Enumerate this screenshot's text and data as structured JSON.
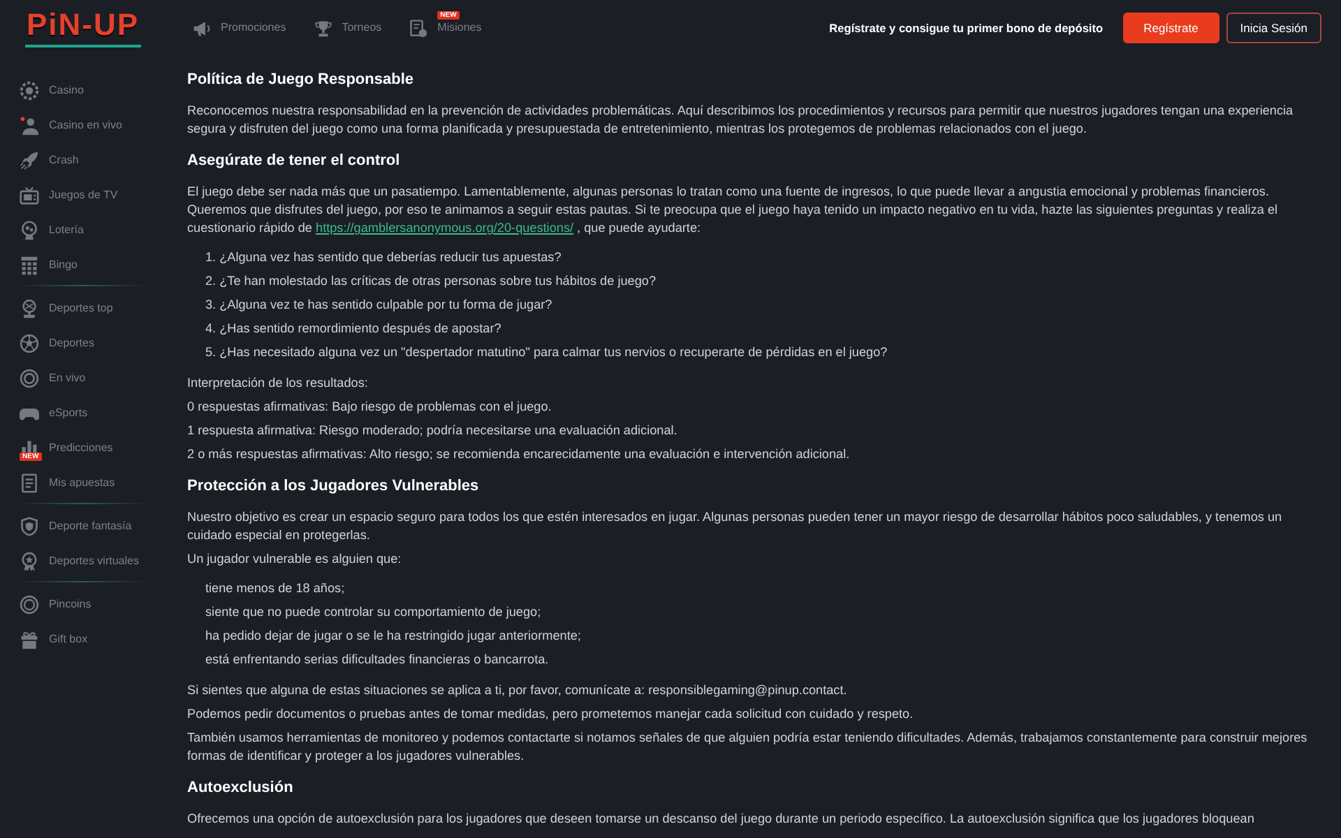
{
  "logo": {
    "text": "PiN-UP"
  },
  "sidebar": {
    "sections": [
      {
        "items": [
          {
            "label": "Casino"
          },
          {
            "label": "Casino en vivo"
          },
          {
            "label": "Crash"
          },
          {
            "label": "Juegos de TV"
          },
          {
            "label": "Lotería"
          },
          {
            "label": "Bingo"
          }
        ]
      },
      {
        "items": [
          {
            "label": "Deportes top"
          },
          {
            "label": "Deportes"
          },
          {
            "label": "En vivo"
          },
          {
            "label": "eSports"
          },
          {
            "label": "Predicciones",
            "badge": "NEW"
          },
          {
            "label": "Mis apuestas"
          }
        ]
      },
      {
        "items": [
          {
            "label": "Deporte fantasía"
          },
          {
            "label": "Deportes virtuales"
          }
        ]
      },
      {
        "items": [
          {
            "label": "Pincoins"
          },
          {
            "label": "Gift box"
          }
        ]
      }
    ]
  },
  "top_nav": [
    {
      "label": "Promociones"
    },
    {
      "label": "Torneos"
    },
    {
      "label": "Misiones",
      "badge": "NEW"
    }
  ],
  "header": {
    "promo": "Regístrate y consigue tu primer bono de depósito",
    "buttons": [
      {
        "label": "Regístrate",
        "kind": "primary"
      },
      {
        "label": "Inicia Sesión",
        "kind": "outline"
      }
    ]
  },
  "content": [
    {
      "kind": "heading",
      "text": "Política de Juego Responsable"
    },
    {
      "kind": "paragraph",
      "parts": [
        {
          "kind": "text",
          "text": "Reconocemos nuestra responsabilidad en la prevención de actividades problemáticas. Aquí describimos los procedimientos y recursos para permitir que nuestros jugadores tengan una experiencia segura y disfruten del juego como una forma planificada y presupuestada de entretenimiento, mientras los protegemos de problemas relacionados con el juego."
        }
      ]
    },
    {
      "kind": "heading",
      "text": "Asegúrate de tener el control"
    },
    {
      "kind": "paragraph",
      "parts": [
        {
          "kind": "text",
          "text": "El juego debe ser nada más que un pasatiempo. Lamentablemente, algunas personas lo tratan como una fuente de ingresos, lo que puede llevar a angustia emocional y problemas financieros. Queremos que disfrutes del juego, por eso te animamos a seguir estas pautas. Si te preocupa que el juego haya tenido un impacto negativo en tu vida, hazte las siguientes preguntas y realiza el cuestionario rápido de "
        },
        {
          "kind": "link",
          "text": "https://gamblersanonymous.org/20-questions/"
        },
        {
          "kind": "text",
          "text": " , que puede ayudarte:"
        }
      ]
    },
    {
      "kind": "list",
      "items": [
        "1. ¿Alguna vez has sentido que deberías reducir tus apuestas?",
        "2. ¿Te han molestado las críticas de otras personas sobre tus hábitos de juego?",
        "3. ¿Alguna vez te has sentido culpable por tu forma de jugar?",
        "4. ¿Has sentido remordimiento después de apostar?",
        "5. ¿Has necesitado alguna vez un \"despertador matutino\" para calmar tus nervios o recuperarte de pérdidas en el juego?"
      ]
    },
    {
      "kind": "paragraph",
      "parts": [
        {
          "kind": "text",
          "text": "Interpretación de los resultados:"
        }
      ]
    },
    {
      "kind": "paragraph",
      "parts": [
        {
          "kind": "text",
          "text": "0 respuestas afirmativas: Bajo riesgo de problemas con el juego."
        }
      ]
    },
    {
      "kind": "paragraph",
      "parts": [
        {
          "kind": "text",
          "text": "1 respuesta afirmativa: Riesgo moderado; podría necesitarse una evaluación adicional."
        }
      ]
    },
    {
      "kind": "paragraph",
      "parts": [
        {
          "kind": "text",
          "text": "2 o más respuestas afirmativas: Alto riesgo; se recomienda encarecidamente una evaluación e intervención adicional."
        }
      ]
    },
    {
      "kind": "heading",
      "text": "Protección a los Jugadores Vulnerables"
    },
    {
      "kind": "paragraph",
      "parts": [
        {
          "kind": "text",
          "text": "Nuestro objetivo es crear un espacio seguro para todos los que estén interesados en jugar. Algunas personas pueden tener un mayor riesgo de desarrollar hábitos poco saludables, y tenemos un cuidado especial en protegerlas."
        }
      ]
    },
    {
      "kind": "paragraph",
      "parts": [
        {
          "kind": "text",
          "text": "Un jugador vulnerable es alguien que:"
        }
      ]
    },
    {
      "kind": "list",
      "items": [
        "tiene menos de 18 años;",
        "siente que no puede controlar su comportamiento de juego;",
        "ha pedido dejar de jugar o se le ha restringido jugar anteriormente;",
        "está enfrentando serias dificultades financieras o bancarrota."
      ]
    },
    {
      "kind": "paragraph",
      "parts": [
        {
          "kind": "text",
          "text": "Si sientes que alguna de estas situaciones se aplica a ti, por favor, comunícate a: responsiblegaming@pinup.contact."
        }
      ]
    },
    {
      "kind": "paragraph",
      "parts": [
        {
          "kind": "text",
          "text": "Podemos pedir documentos o pruebas antes de tomar medidas, pero prometemos manejar cada solicitud con cuidado y respeto."
        }
      ]
    },
    {
      "kind": "paragraph",
      "parts": [
        {
          "kind": "text",
          "text": "También usamos herramientas de monitoreo y podemos contactarte si notamos señales de que alguien podría estar teniendo dificultades. Además, trabajamos constantemente para construir mejores formas de identificar y proteger a los jugadores vulnerables."
        }
      ]
    },
    {
      "kind": "heading",
      "text": "Autoexclusión"
    },
    {
      "kind": "paragraph",
      "parts": [
        {
          "kind": "text",
          "text": "Ofrecemos una opción de autoexclusión para los jugadores que deseen tomarse un descanso del juego durante un periodo específico. La autoexclusión significa que los jugadores bloquean"
        }
      ]
    }
  ]
}
